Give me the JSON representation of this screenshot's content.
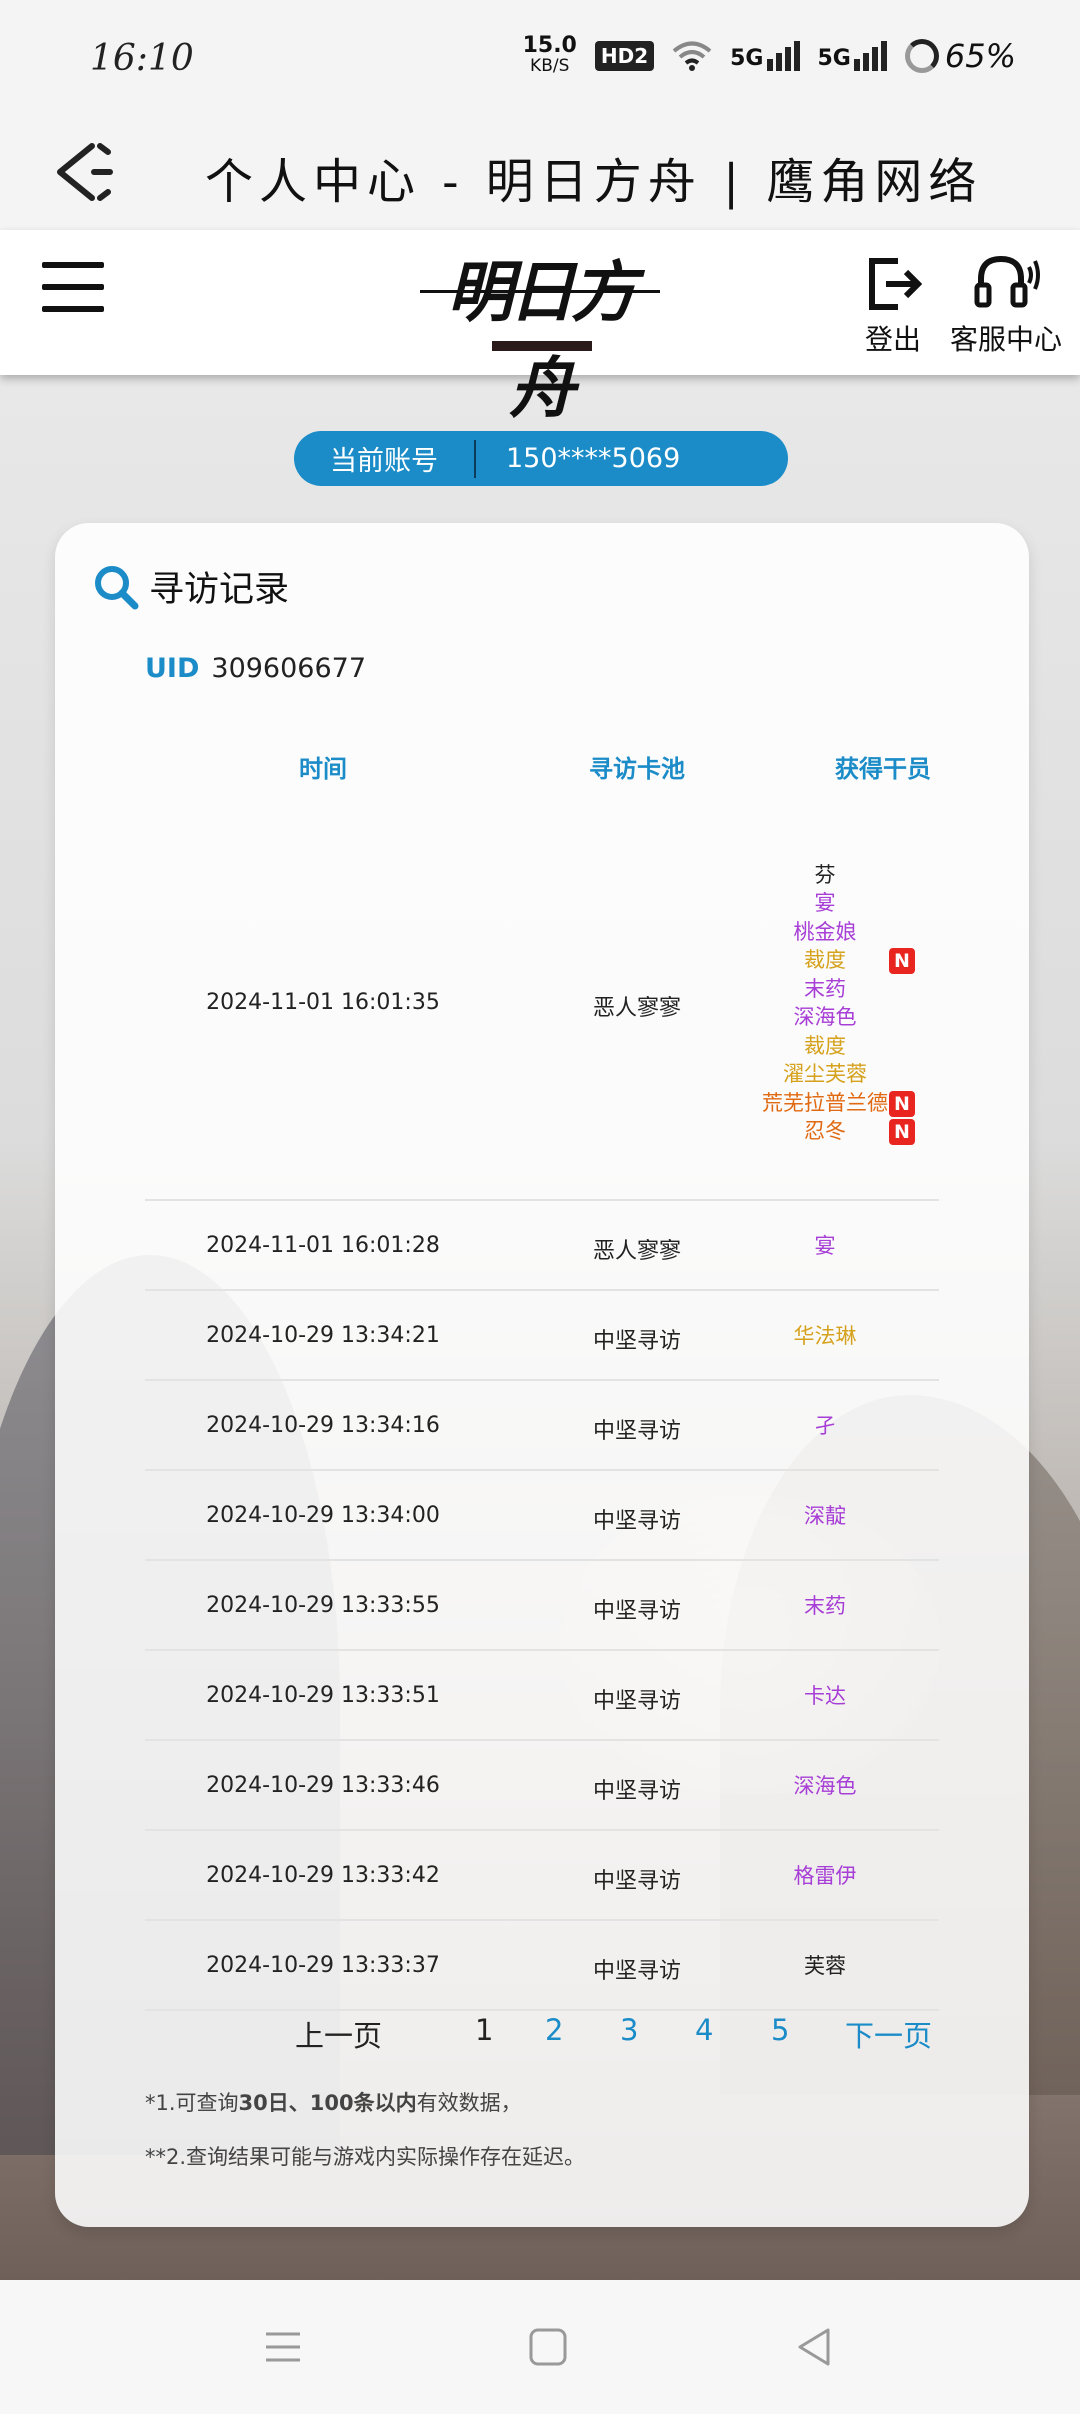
{
  "status_bar": {
    "time": "16:10",
    "speed_value": "15.0",
    "speed_unit": "KB/S",
    "hd_badge": "HD2",
    "signal1": "5G",
    "signal2": "5G",
    "battery": "65%"
  },
  "title_bar": {
    "title": "个人中心 - 明日方舟 | 鹰角网络"
  },
  "header": {
    "logo_text": "明日方舟",
    "logout_label": "登出",
    "service_label": "客服中心"
  },
  "account": {
    "label": "当前账号",
    "value": "150****5069"
  },
  "card": {
    "title": "寻访记录",
    "uid_label": "UID",
    "uid_value": "309606677",
    "columns": [
      "时间",
      "寻访卡池",
      "获得干员"
    ]
  },
  "records": [
    {
      "time": "2024-11-01 16:01:35",
      "pool": "恶人寥寥",
      "operators": [
        {
          "name": "芬",
          "rarity": 3,
          "new": false
        },
        {
          "name": "宴",
          "rarity": 4,
          "new": false
        },
        {
          "name": "桃金娘",
          "rarity": 4,
          "new": false
        },
        {
          "name": "裁度",
          "rarity": 5,
          "new": true
        },
        {
          "name": "末药",
          "rarity": 4,
          "new": false
        },
        {
          "name": "深海色",
          "rarity": 4,
          "new": false
        },
        {
          "name": "裁度",
          "rarity": 5,
          "new": false
        },
        {
          "name": "濯尘芙蓉",
          "rarity": 5,
          "new": false
        },
        {
          "name": "荒芜拉普兰德",
          "rarity": 6,
          "new": true
        },
        {
          "name": "忍冬",
          "rarity": 6,
          "new": true
        }
      ]
    },
    {
      "time": "2024-11-01 16:01:28",
      "pool": "恶人寥寥",
      "operators": [
        {
          "name": "宴",
          "rarity": 4,
          "new": false
        }
      ]
    },
    {
      "time": "2024-10-29 13:34:21",
      "pool": "中坚寻访",
      "operators": [
        {
          "name": "华法琳",
          "rarity": 5,
          "new": false
        }
      ]
    },
    {
      "time": "2024-10-29 13:34:16",
      "pool": "中坚寻访",
      "operators": [
        {
          "name": "孑",
          "rarity": 4,
          "new": false
        }
      ]
    },
    {
      "time": "2024-10-29 13:34:00",
      "pool": "中坚寻访",
      "operators": [
        {
          "name": "深靛",
          "rarity": 4,
          "new": false
        }
      ]
    },
    {
      "time": "2024-10-29 13:33:55",
      "pool": "中坚寻访",
      "operators": [
        {
          "name": "末药",
          "rarity": 4,
          "new": false
        }
      ]
    },
    {
      "time": "2024-10-29 13:33:51",
      "pool": "中坚寻访",
      "operators": [
        {
          "name": "卡达",
          "rarity": 4,
          "new": false
        }
      ]
    },
    {
      "time": "2024-10-29 13:33:46",
      "pool": "中坚寻访",
      "operators": [
        {
          "name": "深海色",
          "rarity": 4,
          "new": false
        }
      ]
    },
    {
      "time": "2024-10-29 13:33:42",
      "pool": "中坚寻访",
      "operators": [
        {
          "name": "格雷伊",
          "rarity": 4,
          "new": false
        }
      ]
    },
    {
      "time": "2024-10-29 13:33:37",
      "pool": "中坚寻访",
      "operators": [
        {
          "name": "芙蓉",
          "rarity": 3,
          "new": false
        }
      ]
    }
  ],
  "new_badge": "N",
  "pagination": {
    "prev": "上一页",
    "pages": [
      "1",
      "2",
      "3",
      "4",
      "5"
    ],
    "current": "1",
    "next": "下一页"
  },
  "notes": {
    "note1_prefix": "*1.可查询",
    "note1_bold": "30日、100条以内",
    "note1_suffix": "有效数据，",
    "note2": "**2.查询结果可能与游戏内实际操作存在延迟。"
  },
  "colors": {
    "accent": "#1b8cc8",
    "rarity3": "#222222",
    "rarity4": "#a73ed6",
    "rarity5": "#d6a21e",
    "rarity6": "#e06a12",
    "new_badge": "#e8261f"
  }
}
